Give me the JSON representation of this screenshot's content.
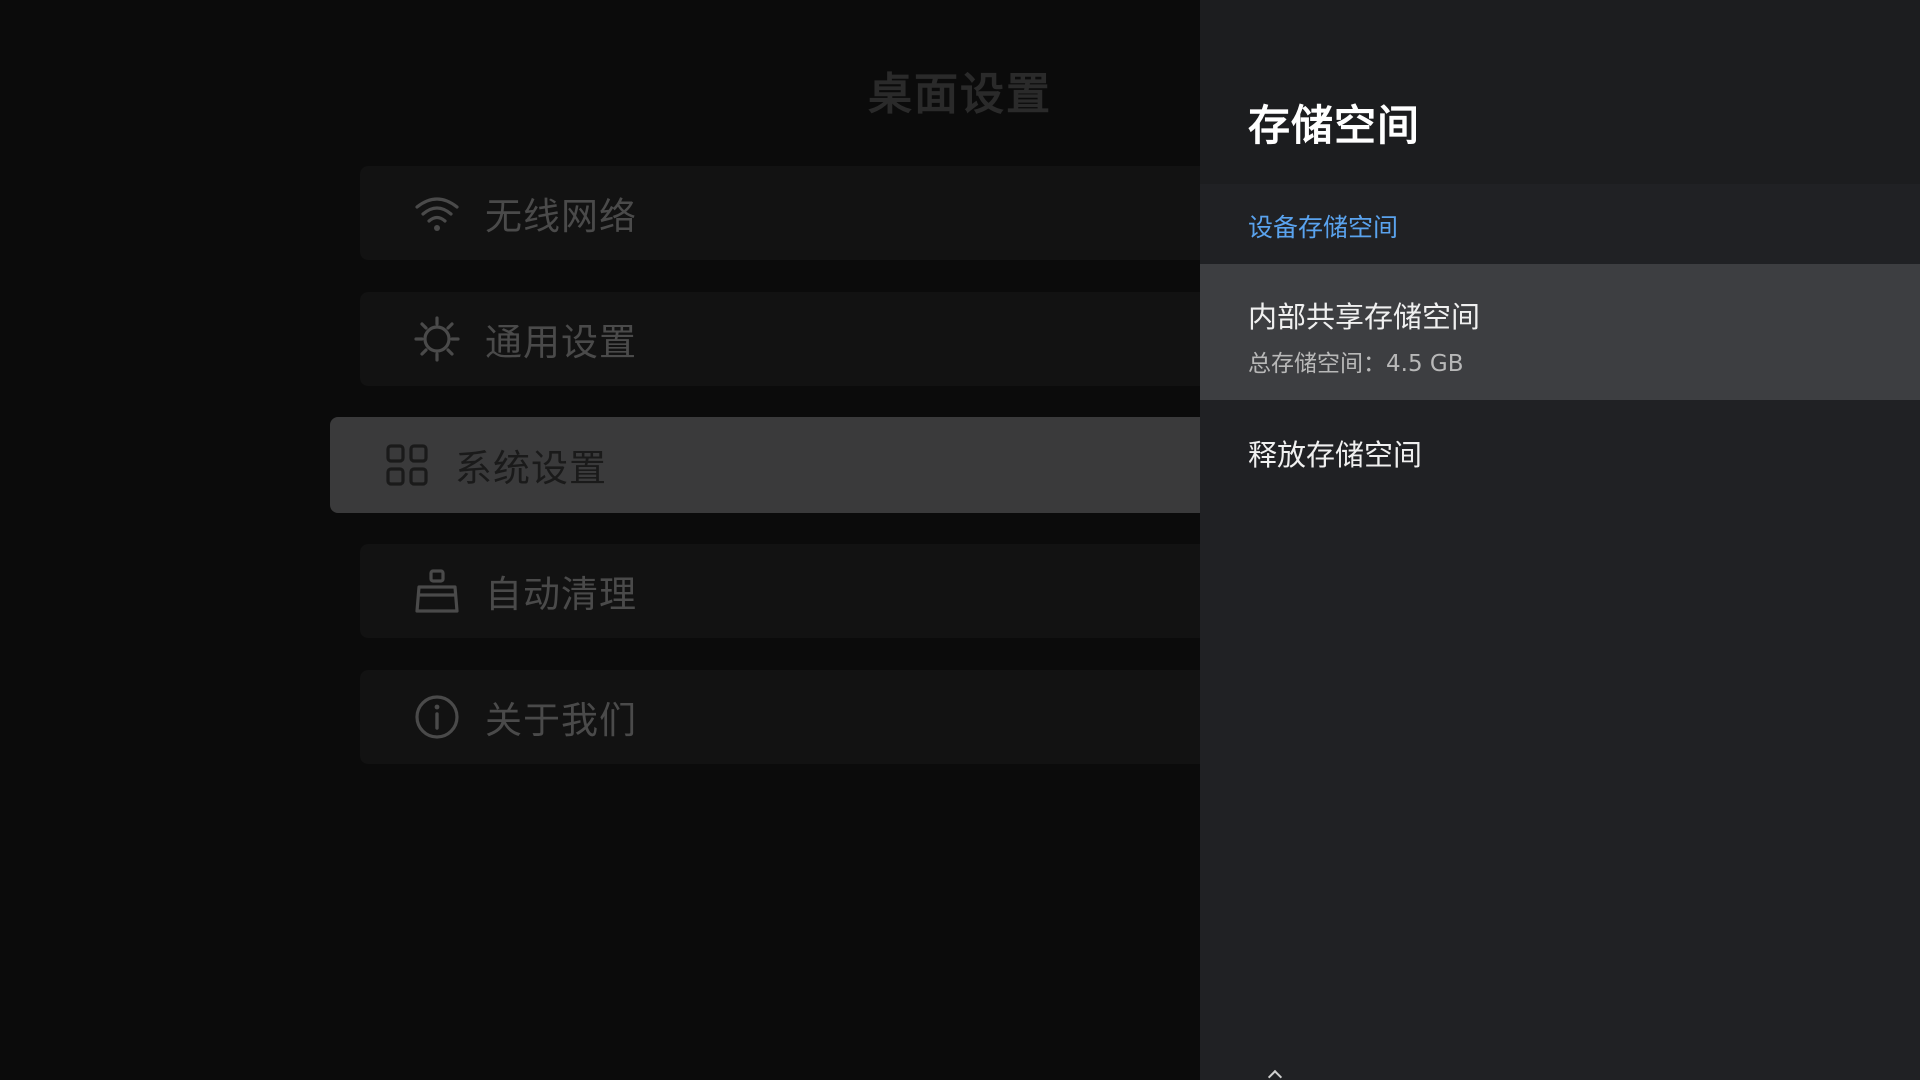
{
  "left_menu": {
    "title": "桌面设置",
    "items": [
      {
        "label": "无线网络",
        "icon": "wifi-icon"
      },
      {
        "label": "通用设置",
        "icon": "gear-icon"
      },
      {
        "label": "系统设置",
        "icon": "grid-icon",
        "active": true
      },
      {
        "label": "自动清理",
        "icon": "broom-icon"
      },
      {
        "label": "关于我们",
        "icon": "info-icon"
      }
    ]
  },
  "storage_panel": {
    "title": "存储空间",
    "section_label": "设备存储空间",
    "internal": {
      "title": "内部共享存储空间",
      "subtitle": "总存储空间：4.5 GB"
    },
    "free_up": {
      "title": "释放存储空间"
    }
  },
  "colors": {
    "accent": "#5aa3ee",
    "panel_bg": "#202124",
    "focus_bg": "#3d3e41",
    "active_menu_bg": "#3a3a3b"
  }
}
